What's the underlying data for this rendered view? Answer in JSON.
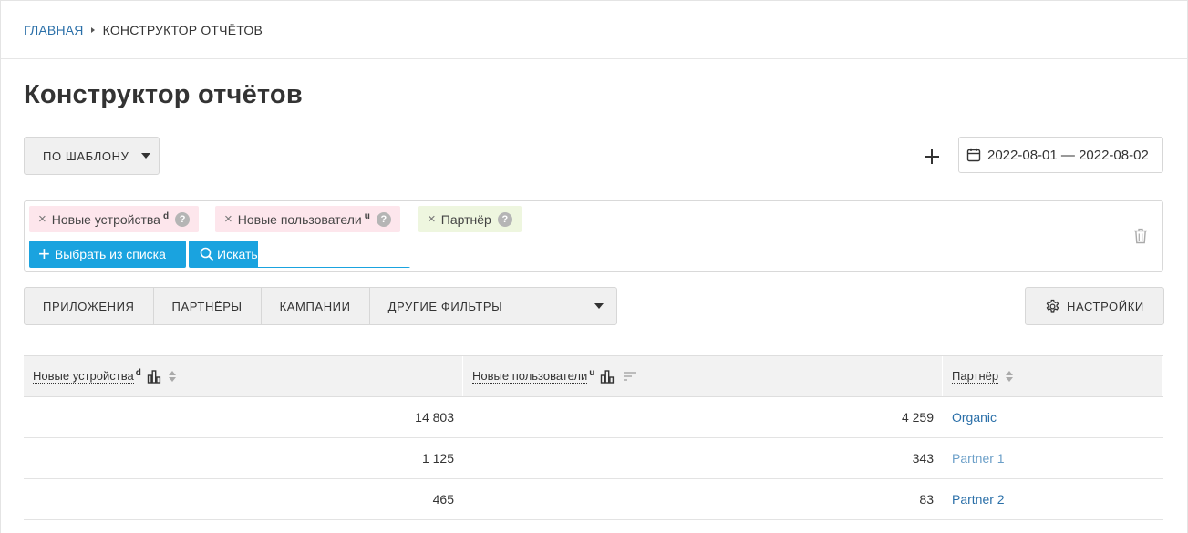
{
  "breadcrumb": {
    "home": "ГЛАВНАЯ",
    "current": "КОНСТРУКТОР ОТЧЁТОВ"
  },
  "page": {
    "title": "Конструктор отчётов"
  },
  "toolbar": {
    "template_label": "ПО ШАБЛОНУ",
    "date_range": "2022-08-01 — 2022-08-02"
  },
  "metrics": {
    "chips": [
      {
        "label": "Новые устройства",
        "sup": "d",
        "help": "?"
      },
      {
        "label": "Новые пользователи",
        "sup": "u",
        "help": "?"
      },
      {
        "label": "Партнёр",
        "sup": "",
        "help": "?"
      }
    ],
    "remove_glyph": "×",
    "select_label": "Выбрать из списка",
    "search_label": "Искать",
    "search_value": "",
    "search_placeholder": ""
  },
  "filters": {
    "apps": "ПРИЛОЖЕНИЯ",
    "partners": "ПАРТНЁРЫ",
    "campaigns": "КАМПАНИИ",
    "other": "ДРУГИЕ ФИЛЬТРЫ"
  },
  "settings": {
    "label": "НАСТРОЙКИ"
  },
  "table": {
    "headers": [
      {
        "label": "Новые устройства",
        "sup": "d"
      },
      {
        "label": "Новые пользователи",
        "sup": "u"
      },
      {
        "label": "Партнёр",
        "sup": ""
      }
    ],
    "rows": [
      {
        "new_devices": "14 803",
        "new_users": "4 259",
        "partner": "Organic"
      },
      {
        "new_devices": "1 125",
        "new_users": "343",
        "partner": "Partner 1"
      },
      {
        "new_devices": "465",
        "new_users": "83",
        "partner": "Partner 2"
      }
    ]
  },
  "colors": {
    "accent": "#1aa3df",
    "link": "#2a6fa8",
    "chip_pink": "#fde6ec",
    "chip_green": "#eef6df"
  },
  "icons": [
    "calendar-icon",
    "plus-icon",
    "trash-icon",
    "gear-icon",
    "search-icon",
    "bar-chart-icon",
    "sort-icon",
    "help-icon",
    "close-icon",
    "caret-down-icon"
  ]
}
